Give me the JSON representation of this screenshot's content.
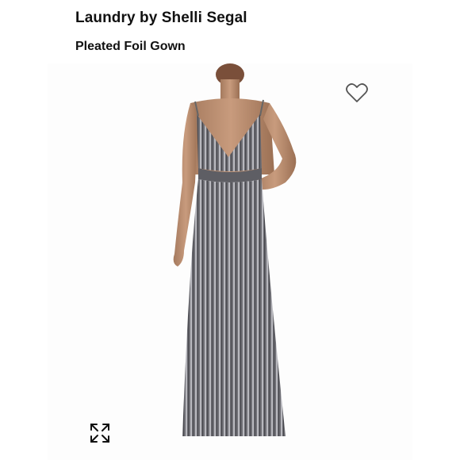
{
  "header": {
    "brand": "Laundry by Shelli Segal",
    "product_name": "Pleated Foil Gown"
  },
  "image": {
    "subject": "Model wearing a silver pleated foil V-neck maxi gown"
  },
  "icons": {
    "favorite": "heart-icon",
    "expand": "expand-icon"
  },
  "colors": {
    "text": "#111111",
    "gown": "#8a8a90"
  }
}
